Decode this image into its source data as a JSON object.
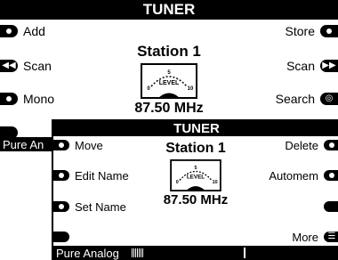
{
  "back": {
    "title": "TUNER",
    "left_keys": [
      {
        "label": "Add",
        "icon": "dot-icon"
      },
      {
        "label": "Scan",
        "icon": "rewind-icon"
      },
      {
        "label": "Mono",
        "icon": "dot-icon"
      },
      {
        "label": "",
        "icon": "blank"
      }
    ],
    "right_keys": [
      {
        "label": "Store",
        "icon": "dot-icon"
      },
      {
        "label": "Scan",
        "icon": "fast-forward-icon"
      },
      {
        "label": "Search",
        "icon": "target-icon"
      }
    ],
    "station": "Station 1",
    "frequency": "87.50 MHz",
    "meter_label": "LEVEL",
    "meter_min": "0",
    "meter_mid": "5",
    "meter_max": "10",
    "status": "Pure An"
  },
  "front": {
    "title": "TUNER",
    "left_keys": [
      {
        "label": "Move",
        "icon": "dot-icon"
      },
      {
        "label": "Edit Name",
        "icon": "dot-icon"
      },
      {
        "label": "Set Name",
        "icon": "dot-icon"
      },
      {
        "label": "",
        "icon": "blank"
      }
    ],
    "right_keys": [
      {
        "label": "Delete",
        "icon": "dot-icon"
      },
      {
        "label": "Automem",
        "icon": "dot-icon"
      },
      {
        "label": "",
        "icon": "blank"
      },
      {
        "label": "More",
        "icon": "more-icon"
      }
    ],
    "station": "Station 1",
    "frequency": "87.50 MHz",
    "meter_label": "LEVEL",
    "meter_min": "0",
    "meter_mid": "5",
    "meter_max": "10",
    "status": "Pure Analog",
    "signal_level": 0.35
  },
  "colors": {
    "foreground": "#000000",
    "background": "#ffffff"
  }
}
